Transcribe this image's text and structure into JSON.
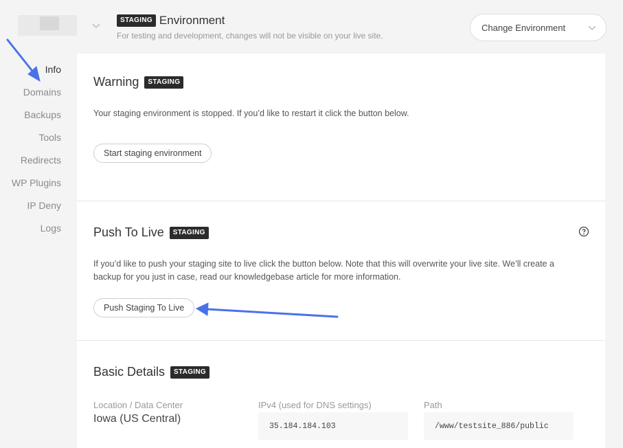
{
  "header": {
    "badge": "STAGING",
    "title": "Environment",
    "subtitle": "For testing and development, changes will not be visible on your live site.",
    "change_env_label": "Change Environment"
  },
  "sidebar": {
    "items": [
      {
        "label": "Info",
        "active": true
      },
      {
        "label": "Domains"
      },
      {
        "label": "Backups"
      },
      {
        "label": "Tools"
      },
      {
        "label": "Redirects"
      },
      {
        "label": "WP Plugins"
      },
      {
        "label": "IP Deny"
      },
      {
        "label": "Logs"
      }
    ]
  },
  "warning": {
    "title": "Warning",
    "badge": "STAGING",
    "text": "Your staging environment is stopped. If you’d like to restart it click the button below.",
    "button": "Start staging environment"
  },
  "push": {
    "title": "Push To Live",
    "badge": "STAGING",
    "text_line1": "If you’d like to push your staging site to live click the button below. Note that this will overwrite your live site. We’ll create a",
    "text_line2": "backup for you just in case, read our knowledgebase article for more information.",
    "button": "Push Staging To Live"
  },
  "basic": {
    "title": "Basic Details",
    "badge": "STAGING",
    "location_label": "Location / Data Center",
    "location_value": "Iowa (US Central)",
    "ipv4_label": "IPv4 (used for DNS settings)",
    "ipv4_value": "35.184.184.103",
    "path_label": "Path",
    "path_value": "/www/testsite_886/public"
  },
  "colors": {
    "annotation_arrow": "#4a72e8",
    "badge_bg": "#2b2b2b",
    "page_bg": "#f4f4f4"
  }
}
